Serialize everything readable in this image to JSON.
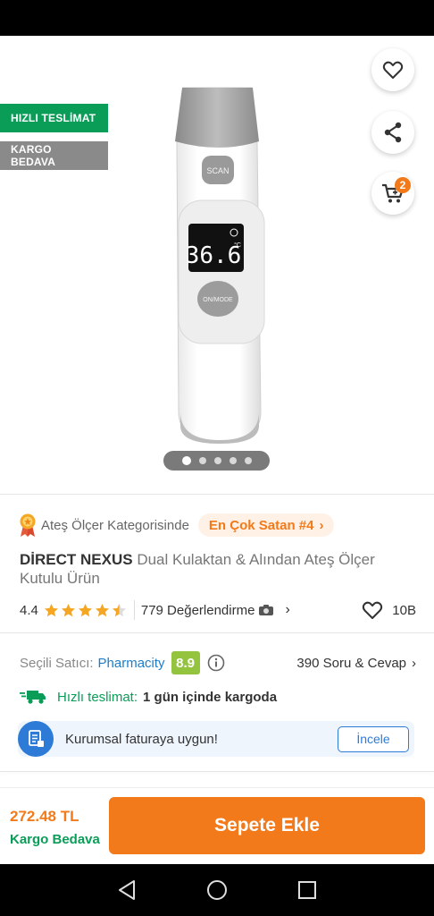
{
  "badges": {
    "fast_delivery": "HIZLI TESLİMAT",
    "free_cargo": "KARGO BEDAVA"
  },
  "cart": {
    "count": "2"
  },
  "gallery": {
    "image_count": 5,
    "active_index": 0
  },
  "product_image": {
    "scan_label": "SCAN",
    "display_value": "36.6",
    "display_unit": "°C",
    "mode_label": "ON/MODE"
  },
  "category": {
    "text": "Ateş Ölçer Kategorisinde",
    "best_seller": "En Çok Satan #4"
  },
  "product": {
    "brand": "DİRECT NEXUS",
    "name": "Dual Kulaktan & Alından Ateş Ölçer Kutulu Ürün"
  },
  "rating": {
    "score": "4.4",
    "stars": 4.5,
    "reviews": "779 Değerlendirme",
    "likes": "10B"
  },
  "seller": {
    "label": "Seçili Satıcı:",
    "name": "Pharmacity",
    "score": "8.9",
    "qa": "390 Soru & Cevap"
  },
  "shipping": {
    "label": "Hızlı teslimat:",
    "value": "1 gün içinde kargoda"
  },
  "invoice": {
    "text": "Kurumsal faturaya uygun!",
    "button": "İncele"
  },
  "footer": {
    "price": "272.48 TL",
    "cargo": "Kargo Bedava",
    "add_to_cart": "Sepete Ekle"
  },
  "colors": {
    "accent": "#f27a1a",
    "green": "#0a9d58",
    "blue": "#2d7bd7",
    "seller_score": "#94c43e",
    "star": "#f5a623"
  }
}
